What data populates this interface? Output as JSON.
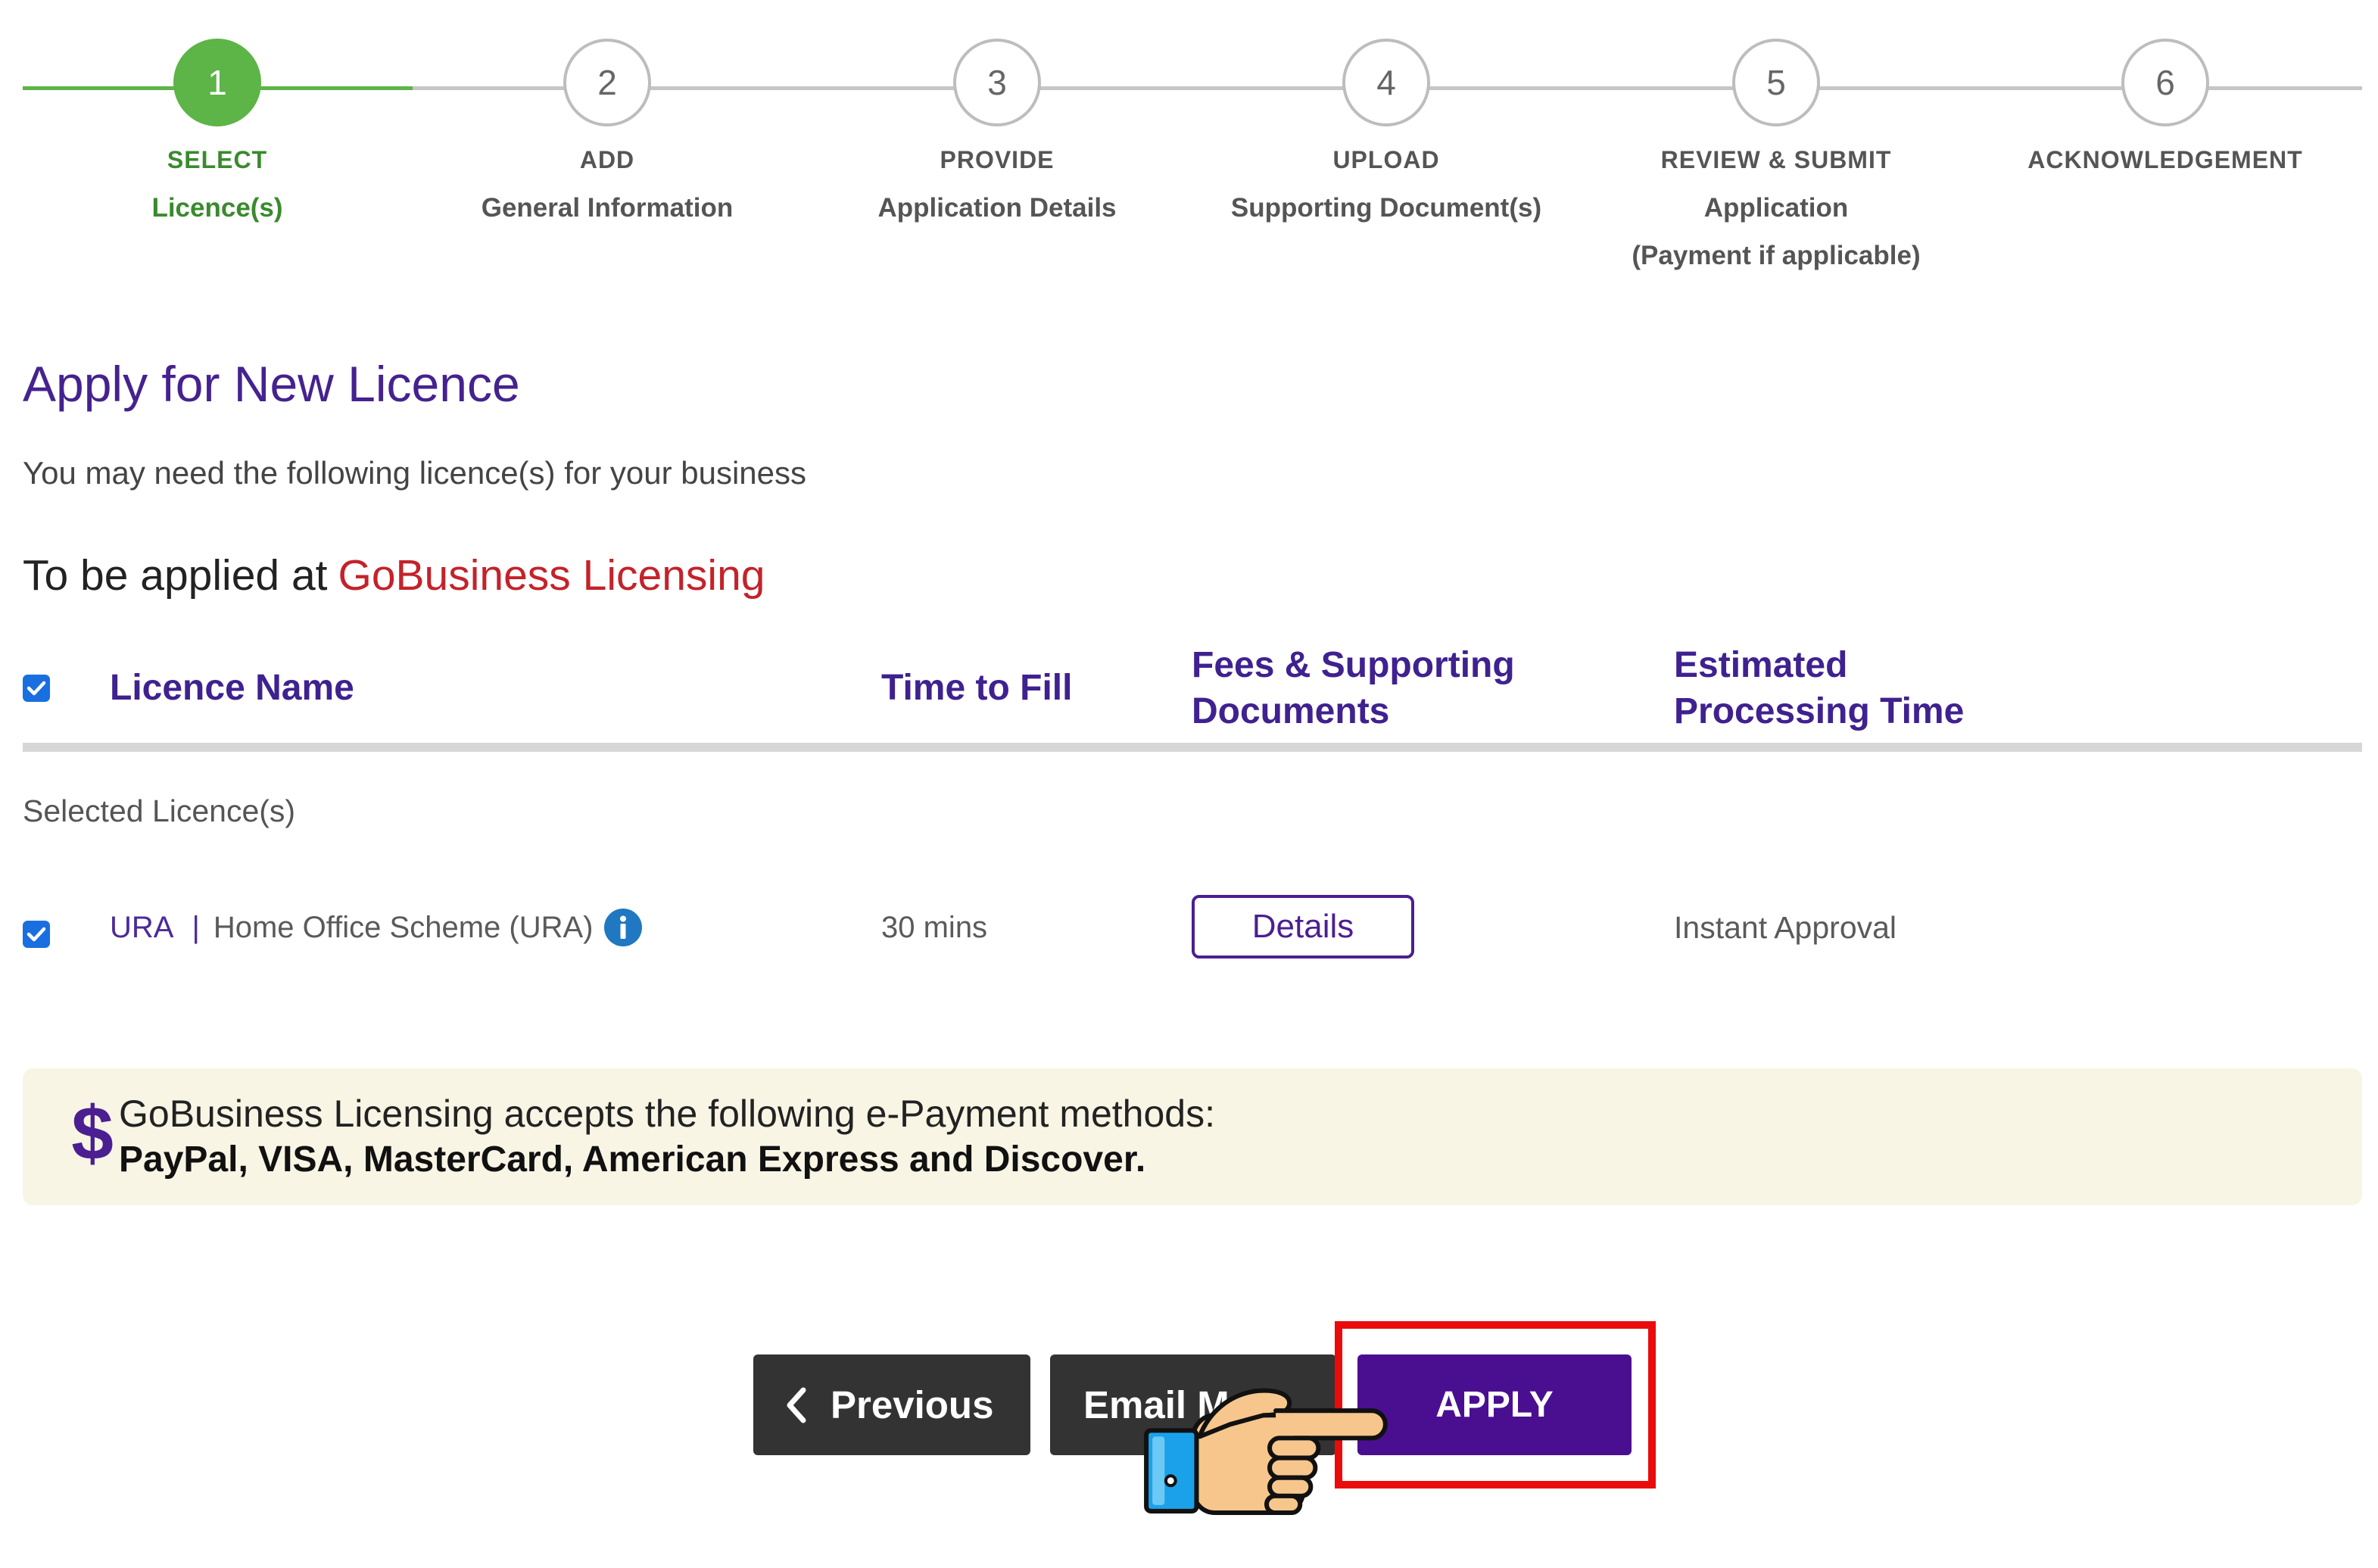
{
  "stepper": {
    "steps": [
      {
        "number": "1",
        "title": "SELECT",
        "subtitle": "Licence(s)",
        "active": true
      },
      {
        "number": "2",
        "title": "ADD",
        "subtitle": "General Information",
        "active": false
      },
      {
        "number": "3",
        "title": "PROVIDE",
        "subtitle": "Application Details",
        "active": false
      },
      {
        "number": "4",
        "title": "UPLOAD",
        "subtitle": "Supporting Document(s)",
        "active": false
      },
      {
        "number": "5",
        "title": "REVIEW & SUBMIT",
        "subtitle": "Application",
        "note": "(Payment if applicable)",
        "active": false
      },
      {
        "number": "6",
        "title": "ACKNOWLEDGEMENT",
        "active": false
      }
    ]
  },
  "page": {
    "title": "Apply for New Licence",
    "intro": "You may need the following licence(s) for your business",
    "section_prefix": "To be applied at",
    "section_highlight": "GoBusiness Licensing"
  },
  "table": {
    "select_all_checked": true,
    "headers": {
      "licence_name": "Licence Name",
      "time_to_fill": "Time to Fill",
      "fees": "Fees & Supporting Documents",
      "processing": "Estimated Processing Time"
    },
    "group_label": "Selected Licence(s)",
    "rows": [
      {
        "checked": true,
        "agency": "URA",
        "separator": "|",
        "name": "Home Office Scheme (URA)",
        "info_icon": "info-icon",
        "time": "30 mins",
        "details_label": "Details",
        "processing": "Instant Approval"
      }
    ]
  },
  "payment_notice": {
    "icon": "dollar-icon",
    "symbol": "$",
    "line1": "GoBusiness Licensing accepts the following e-Payment methods:",
    "line2": "PayPal, VISA, MasterCard, American Express and Discover."
  },
  "actions": {
    "previous_icon": "chevron-left-icon",
    "previous_label": "Previous",
    "email_label": "Email Me",
    "apply_label": "APPLY"
  },
  "annotation": {
    "highlight": "red-highlight-box",
    "pointer": "pointing-hand-icon"
  },
  "colors": {
    "brand_purple": "#4a0f90",
    "step_active_green": "#5db447",
    "highlight_text_red": "#c4222a",
    "annotation_red": "#ea0b0b",
    "notice_background": "#f8f5e5",
    "dark_button": "#333333"
  }
}
